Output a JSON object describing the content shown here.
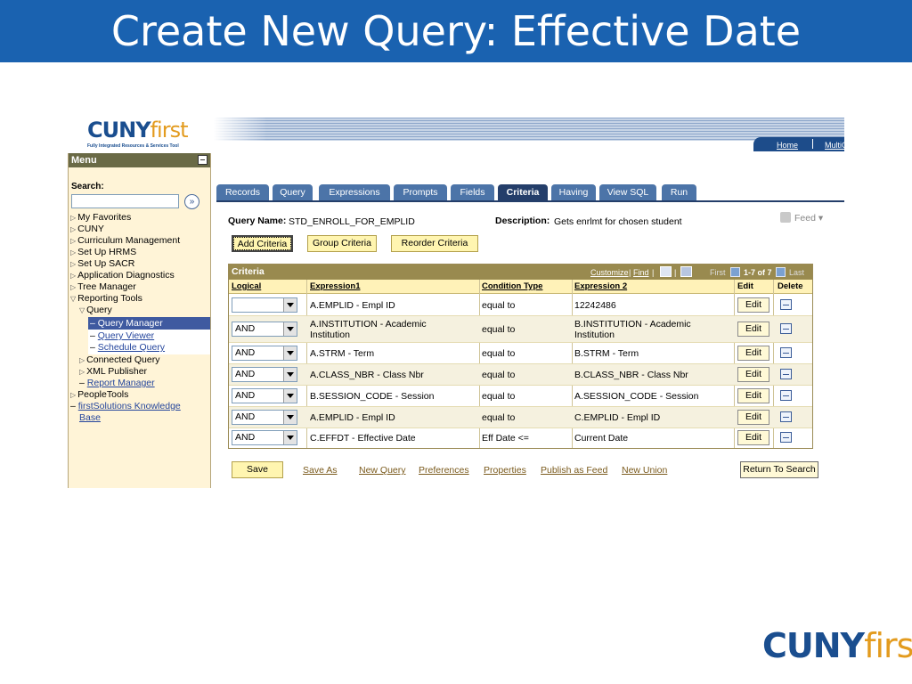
{
  "slide": {
    "title": "Create New Query: Effective Date"
  },
  "logo": {
    "cuny": "CUNY",
    "first": "first",
    "tagline": "Fully Integrated Resources & Services Tool"
  },
  "header_links": {
    "home": "Home",
    "multi": "MultiC"
  },
  "menu": {
    "title": "Menu",
    "search_label": "Search:",
    "search_value": "",
    "search_go": "»",
    "items": [
      {
        "label": "My Favorites"
      },
      {
        "label": "CUNY"
      },
      {
        "label": "Curriculum Management"
      },
      {
        "label": "Set Up HRMS"
      },
      {
        "label": "Set Up SACR"
      },
      {
        "label": "Application Diagnostics"
      },
      {
        "label": "Tree Manager"
      },
      {
        "label": "Reporting Tools"
      },
      {
        "label": "Query"
      },
      {
        "label": "Query Manager"
      },
      {
        "label": "Query Viewer"
      },
      {
        "label": "Schedule Query"
      },
      {
        "label": "Connected Query"
      },
      {
        "label": "XML Publisher"
      },
      {
        "label": "Report Manager"
      },
      {
        "label": "PeopleTools"
      },
      {
        "label": "firstSolutions Knowledge"
      },
      {
        "label": "Base"
      }
    ]
  },
  "tabs": [
    {
      "label": "Records"
    },
    {
      "label": "Query"
    },
    {
      "label": "Expressions"
    },
    {
      "label": "Prompts"
    },
    {
      "label": "Fields"
    },
    {
      "label": "Criteria",
      "active": true
    },
    {
      "label": "Having"
    },
    {
      "label": "View SQL"
    },
    {
      "label": "Run"
    }
  ],
  "query": {
    "name_label": "Query Name:",
    "name_value": "STD_ENROLL_FOR_EMPLID",
    "desc_label": "Description:",
    "desc_value": "Gets enrlmt for chosen student",
    "feed_label": "Feed ▾"
  },
  "actions": {
    "add_criteria": "Add Criteria",
    "group_criteria": "Group Criteria",
    "reorder_criteria": "Reorder Criteria"
  },
  "grid": {
    "title": "Criteria",
    "customize": "Customize",
    "find": "Find",
    "first": "First",
    "range": "1-7 of 7",
    "last": "Last",
    "columns": {
      "logical": "Logical",
      "expression1": "Expression1",
      "condition_type": "Condition Type",
      "expression2": "Expression 2",
      "edit": "Edit",
      "delete": "Delete"
    },
    "rows": [
      {
        "logical": "",
        "expr1": "A.EMPLID - Empl ID",
        "expr1b": "",
        "cond": "equal to",
        "expr2": "12242486",
        "expr2b": "",
        "edit": "Edit"
      },
      {
        "logical": "AND",
        "expr1": "A.INSTITUTION - Academic",
        "expr1b": "Institution",
        "cond": "equal to",
        "expr2": "B.INSTITUTION - Academic",
        "expr2b": "Institution",
        "edit": "Edit"
      },
      {
        "logical": "AND",
        "expr1": "A.STRM - Term",
        "expr1b": "",
        "cond": "equal to",
        "expr2": "B.STRM - Term",
        "expr2b": "",
        "edit": "Edit"
      },
      {
        "logical": "AND",
        "expr1": "A.CLASS_NBR - Class Nbr",
        "expr1b": "",
        "cond": "equal to",
        "expr2": "B.CLASS_NBR - Class Nbr",
        "expr2b": "",
        "edit": "Edit"
      },
      {
        "logical": "AND",
        "expr1": "B.SESSION_CODE - Session",
        "expr1b": "",
        "cond": "equal to",
        "expr2": "A.SESSION_CODE - Session",
        "expr2b": "",
        "edit": "Edit"
      },
      {
        "logical": "AND",
        "expr1": "A.EMPLID - Empl ID",
        "expr1b": "",
        "cond": "equal to",
        "expr2": "C.EMPLID - Empl ID",
        "expr2b": "",
        "edit": "Edit"
      },
      {
        "logical": "AND",
        "expr1": "C.EFFDT - Effective Date",
        "expr1b": "",
        "cond": "Eff Date <=",
        "expr2": "Current Date",
        "expr2b": "",
        "edit": "Edit"
      }
    ]
  },
  "toolbar": {
    "save": "Save",
    "save_as": "Save As",
    "new_query": "New Query",
    "preferences": "Preferences",
    "properties": "Properties",
    "publish_as_feed": "Publish as Feed",
    "new_union": "New Union",
    "return_to_search": "Return To Search"
  }
}
